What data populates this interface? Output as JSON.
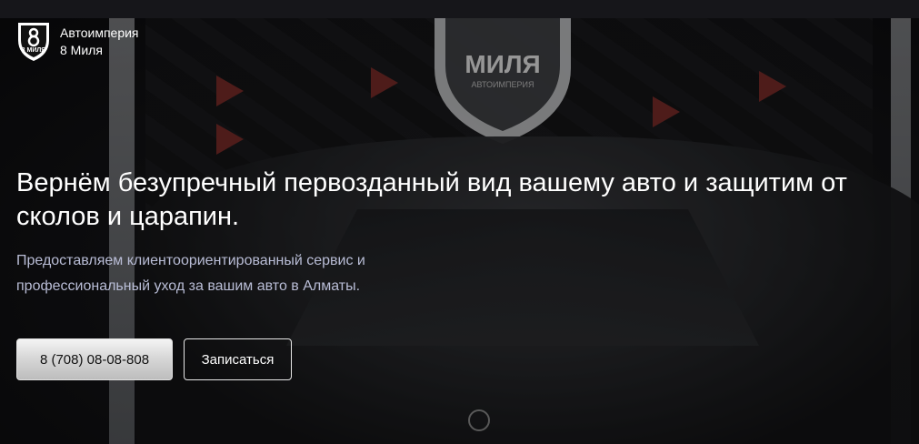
{
  "brand": {
    "name": "Автоимперия",
    "subname": "8 Миля",
    "logo_icon": "shield-logo-icon",
    "logo_text": "8 МИЛЯ"
  },
  "hero": {
    "title": "Вернём безупречный первозданный вид вашему авто и защитим от сколов и царапин.",
    "subtitle": "Предоставляем клиентоориентированный сервис и профессиональный уход за вашим авто в Алматы.",
    "background_sign_text": "МИЛЯ",
    "background_sign_subtext": "АВТОИМПЕРИЯ"
  },
  "actions": {
    "phone_label": "8 (708) 08-08-808",
    "book_label": "Записаться"
  },
  "colors": {
    "accent_red": "#8a2f2b",
    "subtitle_text": "#b9bdd6",
    "background": "#0c0c0f"
  }
}
